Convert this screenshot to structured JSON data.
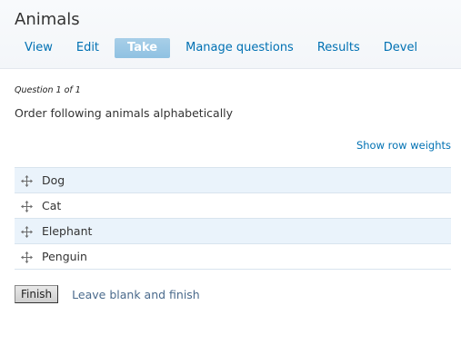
{
  "page": {
    "title": "Animals"
  },
  "tabs": [
    {
      "label": "View",
      "active": false
    },
    {
      "label": "Edit",
      "active": false
    },
    {
      "label": "Take",
      "active": true
    },
    {
      "label": "Manage questions",
      "active": false
    },
    {
      "label": "Results",
      "active": false
    },
    {
      "label": "Devel",
      "active": false
    }
  ],
  "quiz": {
    "question_number": "Question 1 of 1",
    "question_text": "Order following animals alphabetically",
    "row_weights_link": "Show row weights",
    "items": [
      {
        "label": "Dog",
        "icon": "drag-handle-icon"
      },
      {
        "label": "Cat",
        "icon": "drag-handle-icon"
      },
      {
        "label": "Elephant",
        "icon": "drag-handle-icon"
      },
      {
        "label": "Penguin",
        "icon": "drag-handle-icon"
      }
    ],
    "finish_button": "Finish",
    "leave_blank_link": "Leave blank and finish"
  },
  "colors": {
    "link": "#0071b3",
    "active_tab": "#8fc1e2",
    "odd_row": "#eaf3fb"
  }
}
